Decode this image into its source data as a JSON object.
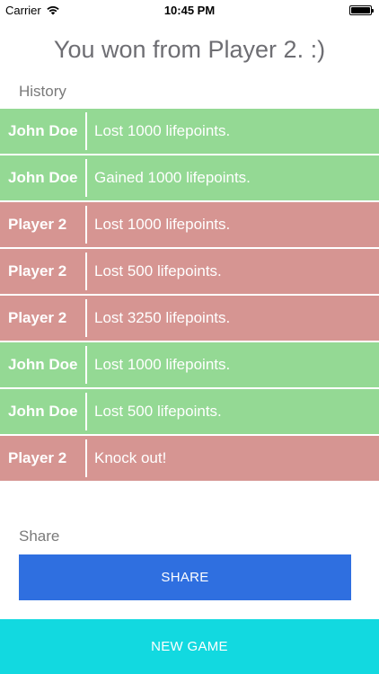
{
  "status_bar": {
    "carrier": "Carrier",
    "time": "10:45 PM",
    "battery_level": 1.0
  },
  "title": "You won from Player 2. :)",
  "history_label": "History",
  "history": [
    {
      "name": "John Doe",
      "event": "Lost 1000 lifepoints.",
      "color": "#94d994"
    },
    {
      "name": "John Doe",
      "event": "Gained 1000 lifepoints.",
      "color": "#94d994"
    },
    {
      "name": "Player 2",
      "event": "Lost 1000 lifepoints.",
      "color": "#d69592"
    },
    {
      "name": "Player 2",
      "event": "Lost 500 lifepoints.",
      "color": "#d69592"
    },
    {
      "name": "Player 2",
      "event": "Lost 3250 lifepoints.",
      "color": "#d69592"
    },
    {
      "name": "John Doe",
      "event": "Lost 1000 lifepoints.",
      "color": "#94d994"
    },
    {
      "name": "John Doe",
      "event": "Lost 500 lifepoints.",
      "color": "#94d994"
    },
    {
      "name": "Player 2",
      "event": "Knock out!",
      "color": "#d69592"
    }
  ],
  "share_label": "Share",
  "share_button": "SHARE",
  "new_game_button": "NEW GAME",
  "colors": {
    "share_button": "#2f6fe0",
    "new_game_button": "#12d9e0"
  }
}
